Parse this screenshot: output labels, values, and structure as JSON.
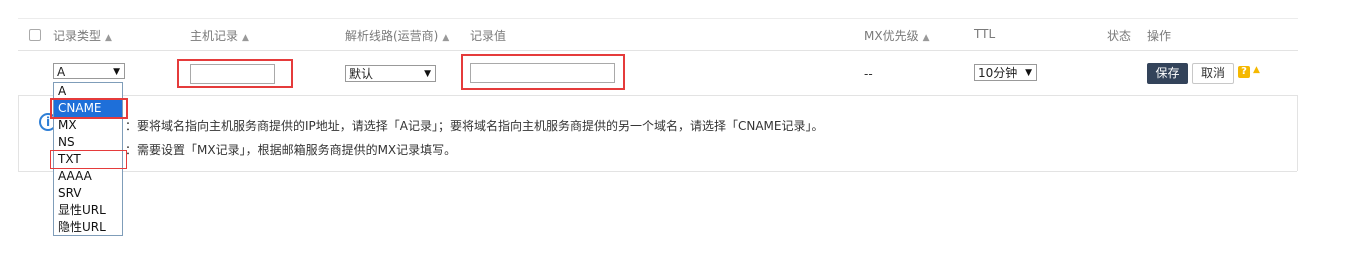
{
  "header": {
    "record_type": "记录类型",
    "host": "主机记录",
    "line": "解析线路(运营商)",
    "value": "记录值",
    "mx_priority": "MX优先级",
    "ttl": "TTL",
    "status": "状态",
    "actions": "操作"
  },
  "row": {
    "record_type_selected": "A",
    "host_value": "",
    "line_selected": "默认",
    "value_value": "",
    "mx_priority": "--",
    "ttl_selected": "10分钟",
    "save_label": "保存",
    "cancel_label": "取消",
    "help_glyph": "?"
  },
  "dropdown_options": [
    "A",
    "CNAME",
    "MX",
    "NS",
    "TXT",
    "AAAA",
    "SRV",
    "显性URL",
    "隐性URL"
  ],
  "dropdown_selected": "CNAME",
  "tips": {
    "line1": "：要将域名指向主机服务商提供的IP地址，请选择「A记录」；要将域名指向主机服务商提供的另一个域名，请选择「CNAME记录」。",
    "line2": "：需要设置「MX记录」，根据邮箱服务商提供的MX记录填写。",
    "info_glyph": "i"
  },
  "colors": {
    "highlight_red": "#e53b3b",
    "selection_blue": "#1e6fd9",
    "save_button": "#33435a",
    "help_yellow": "#f5b800"
  }
}
